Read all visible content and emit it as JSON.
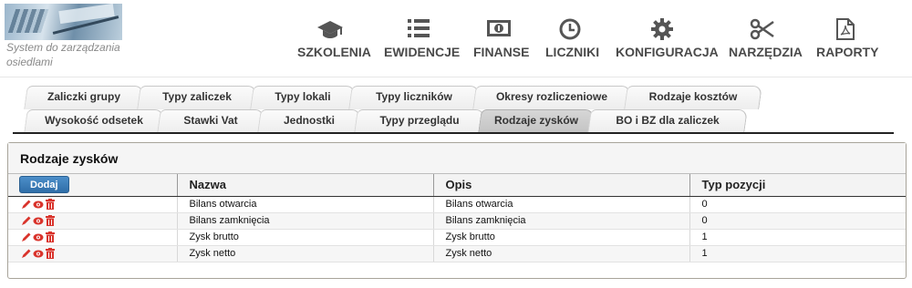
{
  "header": {
    "subtitle": "System do zarządzania osiedlami"
  },
  "nav": [
    {
      "label": "SZKOLENIA",
      "icon": "graduation-cap-icon"
    },
    {
      "label": "EWIDENCJE",
      "icon": "list-icon"
    },
    {
      "label": "FINANSE",
      "icon": "banknote-icon"
    },
    {
      "label": "LICZNIKI",
      "icon": "clock-icon"
    },
    {
      "label": "KONFIGURACJA",
      "icon": "gear-icon"
    },
    {
      "label": "NARZĘDZIA",
      "icon": "scissors-icon"
    },
    {
      "label": "RAPORTY",
      "icon": "pdf-file-icon"
    }
  ],
  "tabs": {
    "row1": [
      "Zaliczki grupy",
      "Typy zaliczek",
      "Typy lokali",
      "Typy liczników",
      "Okresy rozliczeniowe",
      "Rodzaje kosztów"
    ],
    "row2": [
      "Wysokość odsetek",
      "Stawki Vat",
      "Jednostki",
      "Typy przeglądu",
      "Rodzaje zysków",
      "BO i BZ dla zaliczek"
    ],
    "active": "Rodzaje zysków"
  },
  "panel": {
    "title": "Rodzaje zysków",
    "add_button": "Dodaj",
    "columns": [
      "Nazwa",
      "Opis",
      "Typ pozycji"
    ],
    "rows": [
      {
        "nazwa": "Bilans otwarcia",
        "opis": "Bilans otwarcia",
        "typ": "0"
      },
      {
        "nazwa": "Bilans zamknięcia",
        "opis": "Bilans zamknięcia",
        "typ": "0"
      },
      {
        "nazwa": "Zysk brutto",
        "opis": "Zysk brutto",
        "typ": "1"
      },
      {
        "nazwa": "Zysk netto",
        "opis": "Zysk netto",
        "typ": "1"
      }
    ],
    "row_actions": [
      "edit-pencil-icon",
      "view-eye-icon",
      "delete-trash-icon"
    ]
  },
  "colors": {
    "accent": "#2f6ea8",
    "action_red": "#d9332b",
    "nav_text": "#4a4a4a"
  }
}
